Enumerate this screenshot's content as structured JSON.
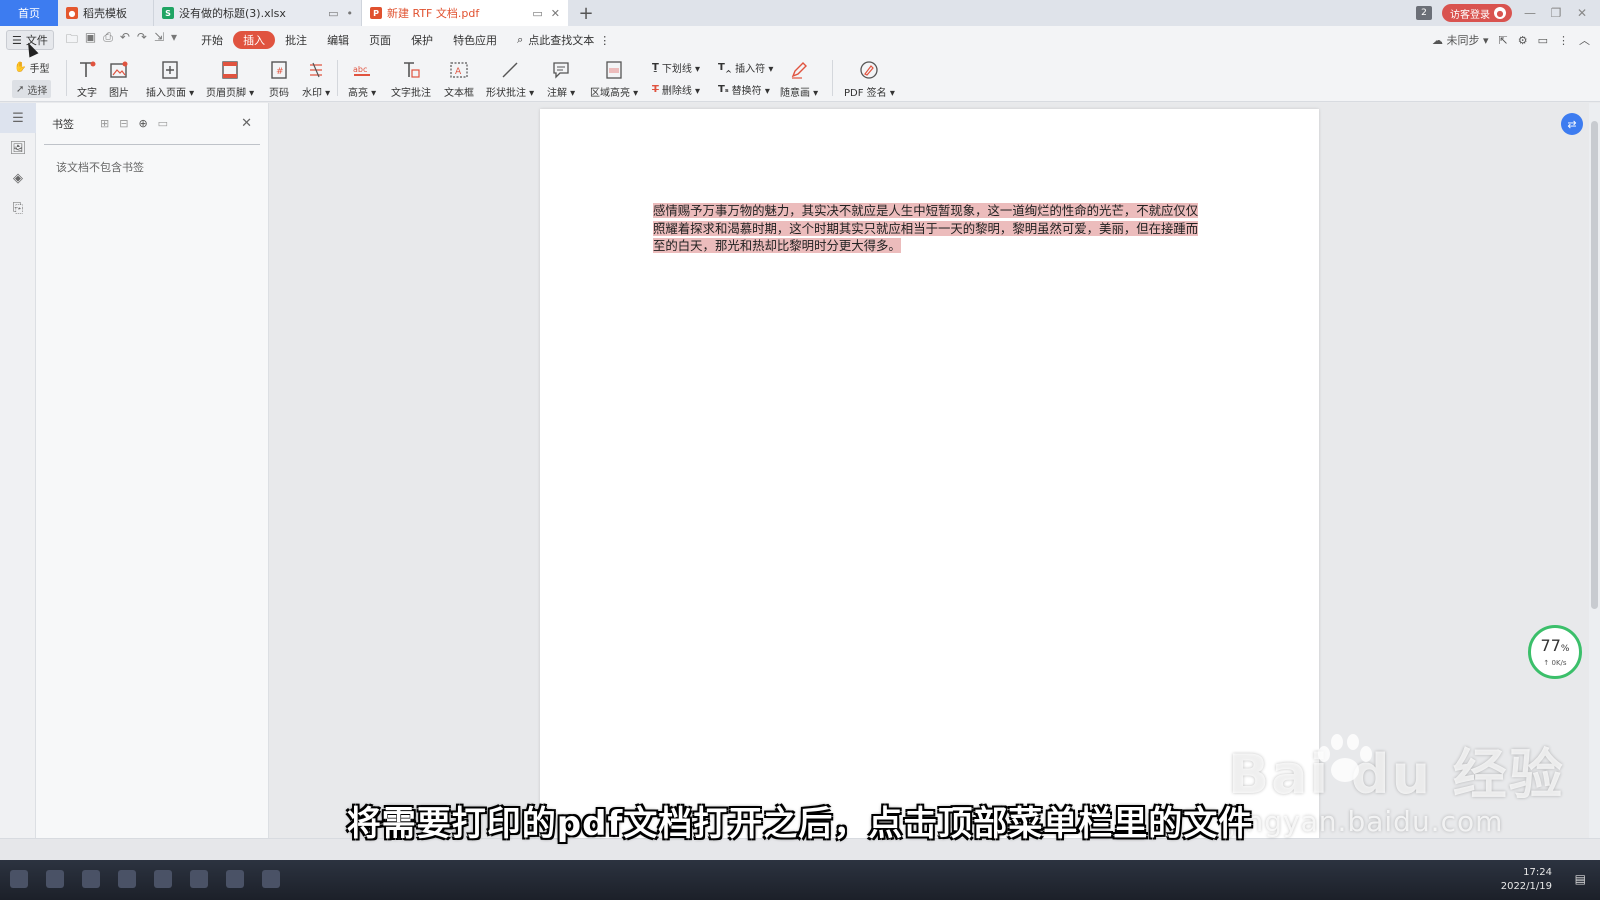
{
  "tabs": {
    "home": "首页",
    "docer": "稻壳模板",
    "xlsx": "没有做的标题(3).xlsx",
    "pdf": "新建 RTF 文档.pdf",
    "window_count": "2",
    "login": "访客登录"
  },
  "menu": {
    "file": "文件",
    "items": [
      "开始",
      "插入",
      "批注",
      "编辑",
      "页面",
      "保护",
      "特色应用"
    ],
    "active_item": "插入",
    "search": "点此查找文本",
    "sync": "未同步"
  },
  "ribbon": {
    "hand": "手型",
    "select": "选择",
    "text": "文字",
    "image": "图片",
    "insert_page": "插入页面",
    "header_footer": "页眉页脚",
    "page_number": "页码",
    "watermark": "水印",
    "highlight": "高亮",
    "text_comment": "文字批注",
    "textbox": "文本框",
    "shape_comment": "形状批注",
    "note": "注解",
    "area_highlight": "区域高亮",
    "underline": "下划线",
    "strikethrough": "删除线",
    "insert_mark": "插入符",
    "replace_mark": "替换符",
    "freehand": "随意画",
    "pdf_sign": "PDF 签名"
  },
  "panel": {
    "title": "书签",
    "empty": "该文档不包含书签"
  },
  "document": {
    "paragraph": "感情赐予万事万物的魅力，其实决不就应是人生中短暂现象，这一道绚烂的性命的光芒，不就应仅仅照耀着探求和渴慕时期，这个时期其实只就应相当于一天的黎明，黎明虽然可爱，美丽，但在接踵而至的白天，那光和热却比黎明时分更大得多。"
  },
  "gauge": {
    "percent": "77",
    "unit": "%",
    "speed": "0K/s"
  },
  "taskbar": {
    "time": "17:24",
    "date": "2022/1/19"
  },
  "subtitle": "将需要打印的pdf文档打开之后，点击顶部菜单栏里的文件",
  "watermark": {
    "top": "Bai  du 经验",
    "bottom": "jingyan.baidu.com"
  },
  "colors": {
    "accent": "#3d7cf0",
    "active_menu": "#e0533f",
    "text_highlight": "#ecbcbc"
  }
}
